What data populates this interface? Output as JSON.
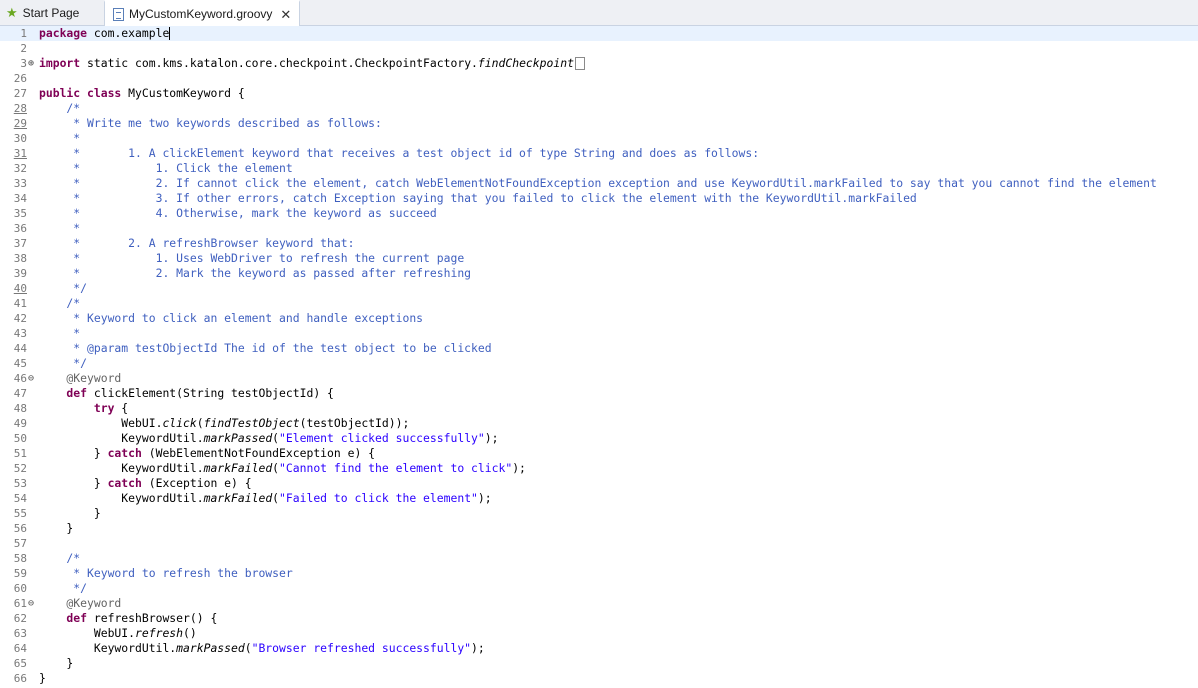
{
  "tabs": {
    "start_page": "Start Page",
    "file": "MyCustomKeyword.groovy"
  },
  "lines": [
    {
      "n": "1",
      "cur": true,
      "parts": [
        [
          "kw",
          "package"
        ],
        [
          "",
          "com.example"
        ]
      ],
      "cursor": true
    },
    {
      "n": "2",
      "parts": []
    },
    {
      "n": "3",
      "fold": "plus",
      "parts": [
        [
          "kw",
          "import"
        ],
        [
          "",
          "static"
        ],
        [
          "",
          ""
        ],
        [
          "",
          "com.kms.katalon.core.checkpoint.CheckpointFactory."
        ],
        [
          "it",
          "findCheckpoint"
        ]
      ],
      "collapsed": true
    },
    {
      "n": "26",
      "parts": []
    },
    {
      "n": "27",
      "parts": [
        [
          "kw",
          "public class"
        ],
        [
          "",
          "MyCustomKeyword {"
        ]
      ]
    },
    {
      "n": "28",
      "ul": true,
      "parts": [
        [
          "cm",
          "    /*"
        ]
      ]
    },
    {
      "n": "29",
      "ul": true,
      "parts": [
        [
          "cm",
          "     * Write me two keywords described as follows:"
        ]
      ]
    },
    {
      "n": "30",
      "parts": [
        [
          "cm",
          "     *"
        ]
      ]
    },
    {
      "n": "31",
      "ul": true,
      "parts": [
        [
          "cm",
          "     *       1. A clickElement keyword that receives a test object id of type String and does as follows:"
        ]
      ]
    },
    {
      "n": "32",
      "parts": [
        [
          "cm",
          "     *           1. Click the element"
        ]
      ]
    },
    {
      "n": "33",
      "parts": [
        [
          "cm",
          "     *           2. If cannot click the element, catch WebElementNotFoundException exception and use KeywordUtil.markFailed to say that you cannot find the element"
        ]
      ]
    },
    {
      "n": "34",
      "parts": [
        [
          "cm",
          "     *           3. If other errors, catch Exception saying that you failed to click the element with the KeywordUtil.markFailed"
        ]
      ]
    },
    {
      "n": "35",
      "parts": [
        [
          "cm",
          "     *           4. Otherwise, mark the keyword as succeed"
        ]
      ]
    },
    {
      "n": "36",
      "parts": [
        [
          "cm",
          "     *"
        ]
      ]
    },
    {
      "n": "37",
      "parts": [
        [
          "cm",
          "     *       2. A refreshBrowser keyword that:"
        ]
      ]
    },
    {
      "n": "38",
      "parts": [
        [
          "cm",
          "     *           1. Uses WebDriver to refresh the current page"
        ]
      ]
    },
    {
      "n": "39",
      "parts": [
        [
          "cm",
          "     *           2. Mark the keyword as passed after refreshing"
        ]
      ]
    },
    {
      "n": "40",
      "ul": true,
      "parts": [
        [
          "cm",
          "     */"
        ]
      ]
    },
    {
      "n": "41",
      "parts": [
        [
          "cm",
          "    /*"
        ]
      ]
    },
    {
      "n": "42",
      "parts": [
        [
          "cm",
          "     * Keyword to click an element and handle exceptions"
        ]
      ]
    },
    {
      "n": "43",
      "parts": [
        [
          "cm",
          "     *"
        ]
      ]
    },
    {
      "n": "44",
      "parts": [
        [
          "cm",
          "     * @param testObjectId The id of the test object to be clicked"
        ]
      ]
    },
    {
      "n": "45",
      "parts": [
        [
          "cm",
          "     */"
        ]
      ]
    },
    {
      "n": "46",
      "fold": "minus",
      "parts": [
        [
          "an",
          "    @Keyword"
        ]
      ]
    },
    {
      "n": "47",
      "parts": [
        [
          "kw",
          "    def"
        ],
        [
          "",
          "clickElement(String testObjectId) {"
        ]
      ]
    },
    {
      "n": "48",
      "parts": [
        [
          "kw",
          "        try"
        ],
        [
          "",
          "{"
        ]
      ]
    },
    {
      "n": "49",
      "parts": [
        [
          "",
          "            WebUI."
        ],
        [
          "it",
          "click"
        ],
        [
          "",
          "("
        ],
        [
          "it",
          "findTestObject"
        ],
        [
          "",
          "(testObjectId));"
        ]
      ]
    },
    {
      "n": "50",
      "parts": [
        [
          "",
          "            KeywordUtil."
        ],
        [
          "it",
          "markPassed"
        ],
        [
          "",
          "("
        ],
        [
          "st",
          "\"Element clicked successfully\""
        ],
        [
          "",
          ");"
        ]
      ]
    },
    {
      "n": "51",
      "parts": [
        [
          "",
          "        } "
        ],
        [
          "kw",
          "catch"
        ],
        [
          "",
          "(WebElementNotFoundException e) {"
        ]
      ]
    },
    {
      "n": "52",
      "parts": [
        [
          "",
          "            KeywordUtil."
        ],
        [
          "it",
          "markFailed"
        ],
        [
          "",
          "("
        ],
        [
          "st",
          "\"Cannot find the element to click\""
        ],
        [
          "",
          ");"
        ]
      ]
    },
    {
      "n": "53",
      "parts": [
        [
          "",
          "        } "
        ],
        [
          "kw",
          "catch"
        ],
        [
          "",
          "(Exception e) {"
        ]
      ]
    },
    {
      "n": "54",
      "parts": [
        [
          "",
          "            KeywordUtil."
        ],
        [
          "it",
          "markFailed"
        ],
        [
          "",
          "("
        ],
        [
          "st",
          "\"Failed to click the element\""
        ],
        [
          "",
          ");"
        ]
      ]
    },
    {
      "n": "55",
      "parts": [
        [
          "",
          "        }"
        ]
      ]
    },
    {
      "n": "56",
      "parts": [
        [
          "",
          "    }"
        ]
      ]
    },
    {
      "n": "57",
      "parts": []
    },
    {
      "n": "58",
      "parts": [
        [
          "cm",
          "    /*"
        ]
      ]
    },
    {
      "n": "59",
      "parts": [
        [
          "cm",
          "     * Keyword to refresh the browser"
        ]
      ]
    },
    {
      "n": "60",
      "parts": [
        [
          "cm",
          "     */"
        ]
      ]
    },
    {
      "n": "61",
      "fold": "minus",
      "parts": [
        [
          "an",
          "    @Keyword"
        ]
      ]
    },
    {
      "n": "62",
      "parts": [
        [
          "kw",
          "    def"
        ],
        [
          "",
          "refreshBrowser() {"
        ]
      ]
    },
    {
      "n": "63",
      "parts": [
        [
          "",
          "        WebUI."
        ],
        [
          "it",
          "refresh"
        ],
        [
          "",
          "()"
        ]
      ]
    },
    {
      "n": "64",
      "parts": [
        [
          "",
          "        KeywordUtil."
        ],
        [
          "it",
          "markPassed"
        ],
        [
          "",
          "("
        ],
        [
          "st",
          "\"Browser refreshed successfully\""
        ],
        [
          "",
          ");"
        ]
      ]
    },
    {
      "n": "65",
      "parts": [
        [
          "",
          "    }"
        ]
      ]
    },
    {
      "n": "66",
      "parts": [
        [
          "",
          "}"
        ]
      ]
    }
  ]
}
